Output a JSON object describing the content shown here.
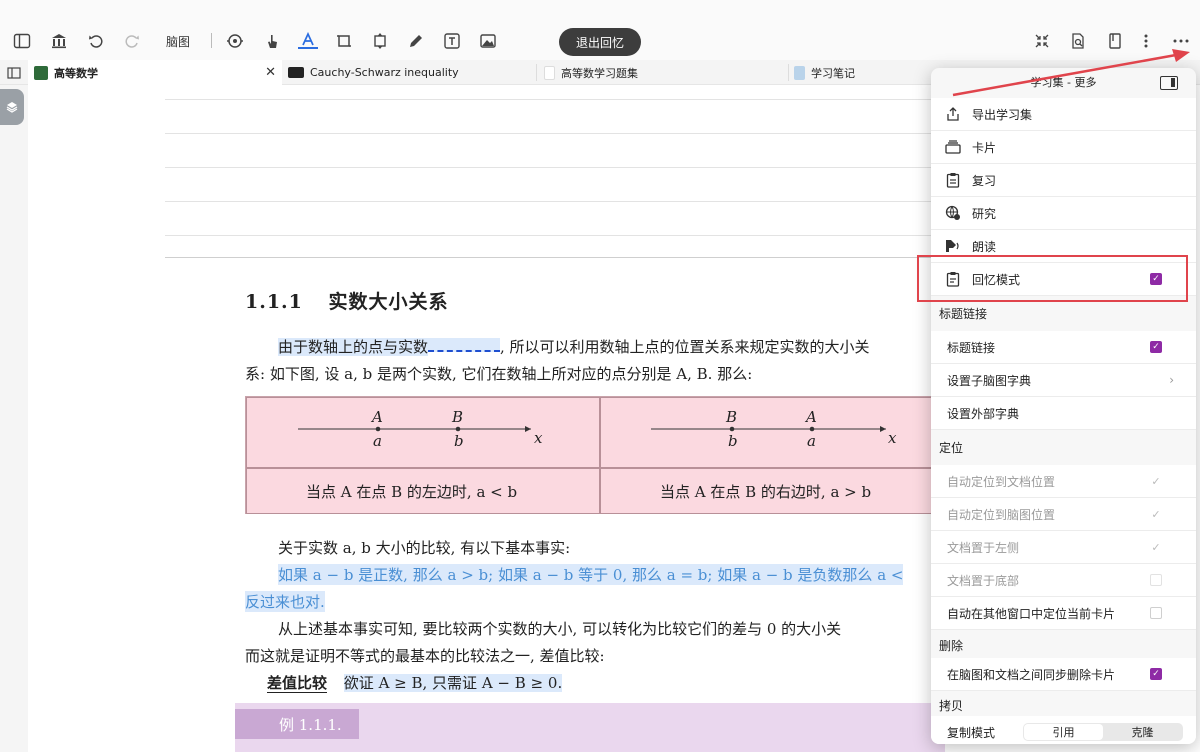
{
  "toolbar": {
    "mindmap_label": "脑图",
    "exit_recall_label": "退出回忆",
    "icons": [
      "sidebar-icon",
      "library-icon",
      "undo-icon",
      "redo-icon",
      "mindmap-icon",
      "lasso-icon",
      "hand-icon",
      "text-highlight-icon",
      "crop-icon",
      "transform-icon",
      "pen-icon",
      "textbox-icon",
      "image-icon",
      "collapse-icon",
      "doc-search-icon",
      "book-icon",
      "vertical-more-icon",
      "more-icon"
    ]
  },
  "tabs": [
    {
      "label": "高等数学",
      "color": "#2f6b3a"
    },
    {
      "label": "Cauchy-Schwarz inequality",
      "color": "#222222"
    },
    {
      "label": "高等数学习题集",
      "color": "#ffffff"
    },
    {
      "label": "学习笔记",
      "color": "#b9d3ea"
    }
  ],
  "doc": {
    "heading_num": "1.1.1",
    "heading_text": "实数大小关系",
    "p1a": "由于数轴上的点与实数",
    "p1b": ", 所以可以利用数轴上点的位置关系来规定实数的大小关",
    "p2": "系: 如下图, 设 a, b 是两个实数, 它们在数轴上所对应的点分别是 A, B. 那么:",
    "fig": {
      "left": {
        "P1": "A",
        "p1": "a",
        "P2": "B",
        "p2": "b",
        "axis": "x",
        "caption": "当点 A 在点 B 的左边时, a < b"
      },
      "right": {
        "P1": "B",
        "p1": "b",
        "P2": "A",
        "p2": "a",
        "axis": "x",
        "caption": "当点 A 在点 B 的右边时, a > b"
      }
    },
    "p3": "关于实数 a, b 大小的比较, 有以下基本事实:",
    "p4": "如果 a − b 是正数, 那么 a > b; 如果 a − b 等于 0, 那么 a = b; 如果 a − b 是负数那么 a <",
    "p5": "反过来也对.",
    "p6": "从上述基本事实可知, 要比较两个实数的大小, 可以转化为比较它们的差与 0 的大小关",
    "p7": "而这就是证明不等式的最基本的比较法之一, 差值比较:",
    "p8a": "差值比较",
    "p8b": "欲证 A ≥ B, 只需证 A − B ≥ 0.",
    "example": "例 1.1.1."
  },
  "menu": {
    "title": "学习集 - 更多",
    "items": [
      {
        "label": "导出学习集",
        "icon": "export-icon"
      },
      {
        "label": "卡片",
        "icon": "cards-icon"
      },
      {
        "label": "复习",
        "icon": "review-icon"
      },
      {
        "label": "研究",
        "icon": "research-icon"
      },
      {
        "label": "朗读",
        "icon": "read-aloud-icon"
      },
      {
        "label": "回忆模式",
        "icon": "recall-icon",
        "checked": true
      }
    ],
    "section_title_link": "标题链接",
    "title_link_label": "标题链接",
    "submindmap_dict": "设置子脑图字典",
    "external_dict": "设置外部字典",
    "section_locate": "定位",
    "locate_items": [
      {
        "label": "自动定位到文档位置",
        "state": "grey-check"
      },
      {
        "label": "自动定位到脑图位置",
        "state": "grey-check"
      },
      {
        "label": "文档置于左侧",
        "state": "grey-check"
      },
      {
        "label": "文档置于底部",
        "state": "off"
      }
    ],
    "auto_locate_other": "自动在其他窗口中定位当前卡片",
    "section_delete": "删除",
    "sync_delete": "在脑图和文档之间同步删除卡片",
    "section_copy": "拷贝",
    "copy_mode": "复制模式",
    "copy_options": [
      "引用",
      "克隆"
    ],
    "check_glyph": "✓"
  },
  "colors": {
    "accent_check": "#8e2aa5",
    "annotation_red": "#e0444c",
    "highlight_blue": "#dbe9fb"
  }
}
